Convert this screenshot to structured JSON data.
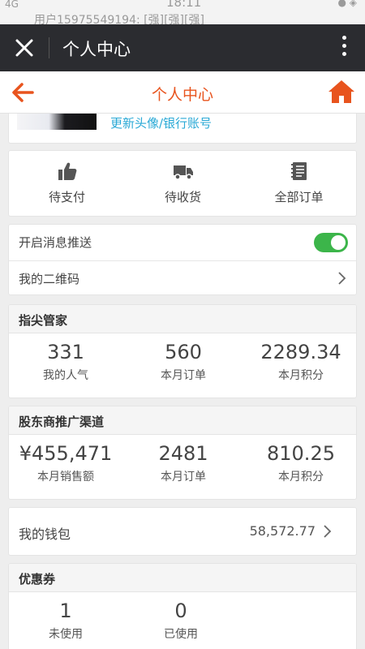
{
  "statusbar": {
    "signal": "4G",
    "notification": "用户15975549194: [强][强][强]",
    "time": "18:11"
  },
  "wechat_bar": {
    "title": "个人中心"
  },
  "header": {
    "title": "个人中心",
    "accent_color": "#e8541e"
  },
  "profile": {
    "link_label": "更新头像/银行账号"
  },
  "orders": [
    {
      "label": "待支付",
      "icon": "thumbs-up-icon"
    },
    {
      "label": "待收货",
      "icon": "truck-icon"
    },
    {
      "label": "全部订单",
      "icon": "document-icon"
    }
  ],
  "settings": {
    "push_label": "开启消息推送",
    "push_enabled": true,
    "qrcode_label": "我的二维码"
  },
  "manager": {
    "title": "指尖管家",
    "stats": [
      {
        "value": "331",
        "label": "我的人气"
      },
      {
        "value": "560",
        "label": "本月订单"
      },
      {
        "value": "2289.34",
        "label": "本月积分"
      }
    ]
  },
  "channel": {
    "title": "股东商推广渠道",
    "stats": [
      {
        "value": "¥455,471",
        "label": "本月销售额"
      },
      {
        "value": "2481",
        "label": "本月订单"
      },
      {
        "value": "810.25",
        "label": "本月积分"
      }
    ]
  },
  "wallet": {
    "label": "我的钱包",
    "amount": "58,572.77"
  },
  "coupons": {
    "title": "优惠券",
    "stats": [
      {
        "value": "1",
        "label": "未使用"
      },
      {
        "value": "0",
        "label": "已使用"
      }
    ]
  }
}
